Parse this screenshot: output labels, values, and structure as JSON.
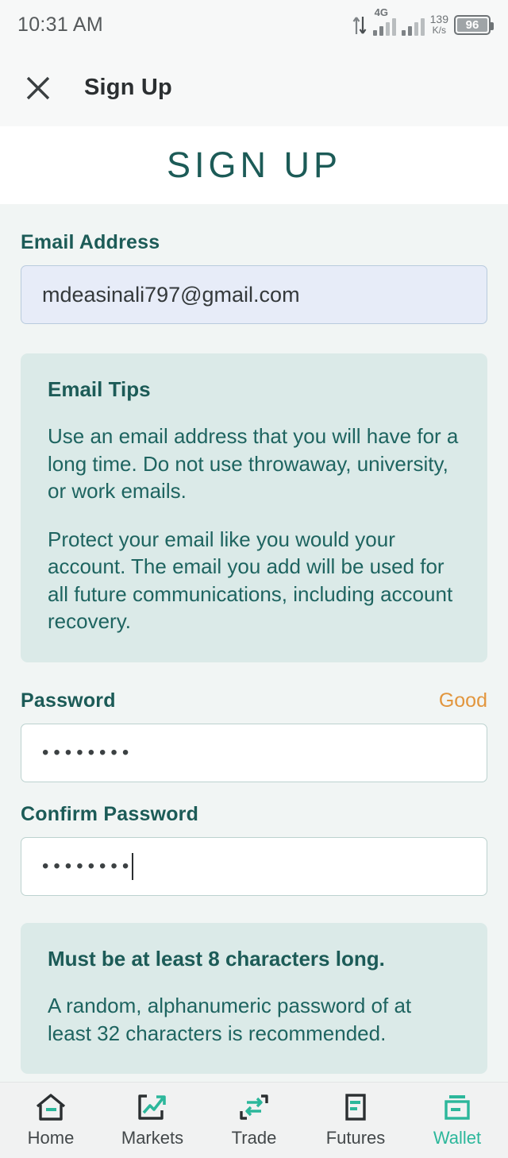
{
  "statusbar": {
    "time": "10:31 AM",
    "network_type": "4G",
    "net_speed_value": "139",
    "net_speed_unit": "K/s",
    "battery_level": "96",
    "icons": {
      "data_transfer": "data-transfer-icon",
      "signal": "signal-bars-icon",
      "battery": "battery-icon"
    }
  },
  "appbar": {
    "close_icon": "close-icon",
    "title": "Sign Up"
  },
  "page": {
    "heading": "SIGN UP"
  },
  "form": {
    "email": {
      "label": "Email Address",
      "value": "mdeasinali797@gmail.com",
      "placeholder": "Email Address"
    },
    "email_tips": {
      "title": "Email Tips",
      "paragraphs": [
        "Use an email address that you will have for a long time. Do not use throwaway, university, or work emails.",
        "Protect your email like you would your account. The email you add will be used for all future communications, including account recovery."
      ]
    },
    "password": {
      "label": "Password",
      "strength": "Good",
      "value": "••••••••",
      "placeholder": "Password"
    },
    "confirm_password": {
      "label": "Confirm Password",
      "value": "••••••••",
      "placeholder": "Confirm Password"
    },
    "password_tips": {
      "title": "Must be at least 8 characters long.",
      "paragraphs": [
        "A random, alphanumeric password of at least 32 characters is recommended."
      ]
    }
  },
  "bottom_nav": {
    "items": [
      {
        "label": "Home",
        "icon": "home-icon",
        "active": false
      },
      {
        "label": "Markets",
        "icon": "markets-chart-icon",
        "active": false
      },
      {
        "label": "Trade",
        "icon": "trade-swap-icon",
        "active": false
      },
      {
        "label": "Futures",
        "icon": "futures-document-icon",
        "active": false
      },
      {
        "label": "Wallet",
        "icon": "wallet-icon",
        "active": true
      }
    ]
  },
  "colors": {
    "teal_dark": "#1c5b57",
    "teal_accent": "#2cb79b",
    "orange_status": "#e2963e",
    "tip_bg": "#dbeae8",
    "email_field_bg": "#e7ecf8",
    "page_bg": "#f1f5f4"
  }
}
